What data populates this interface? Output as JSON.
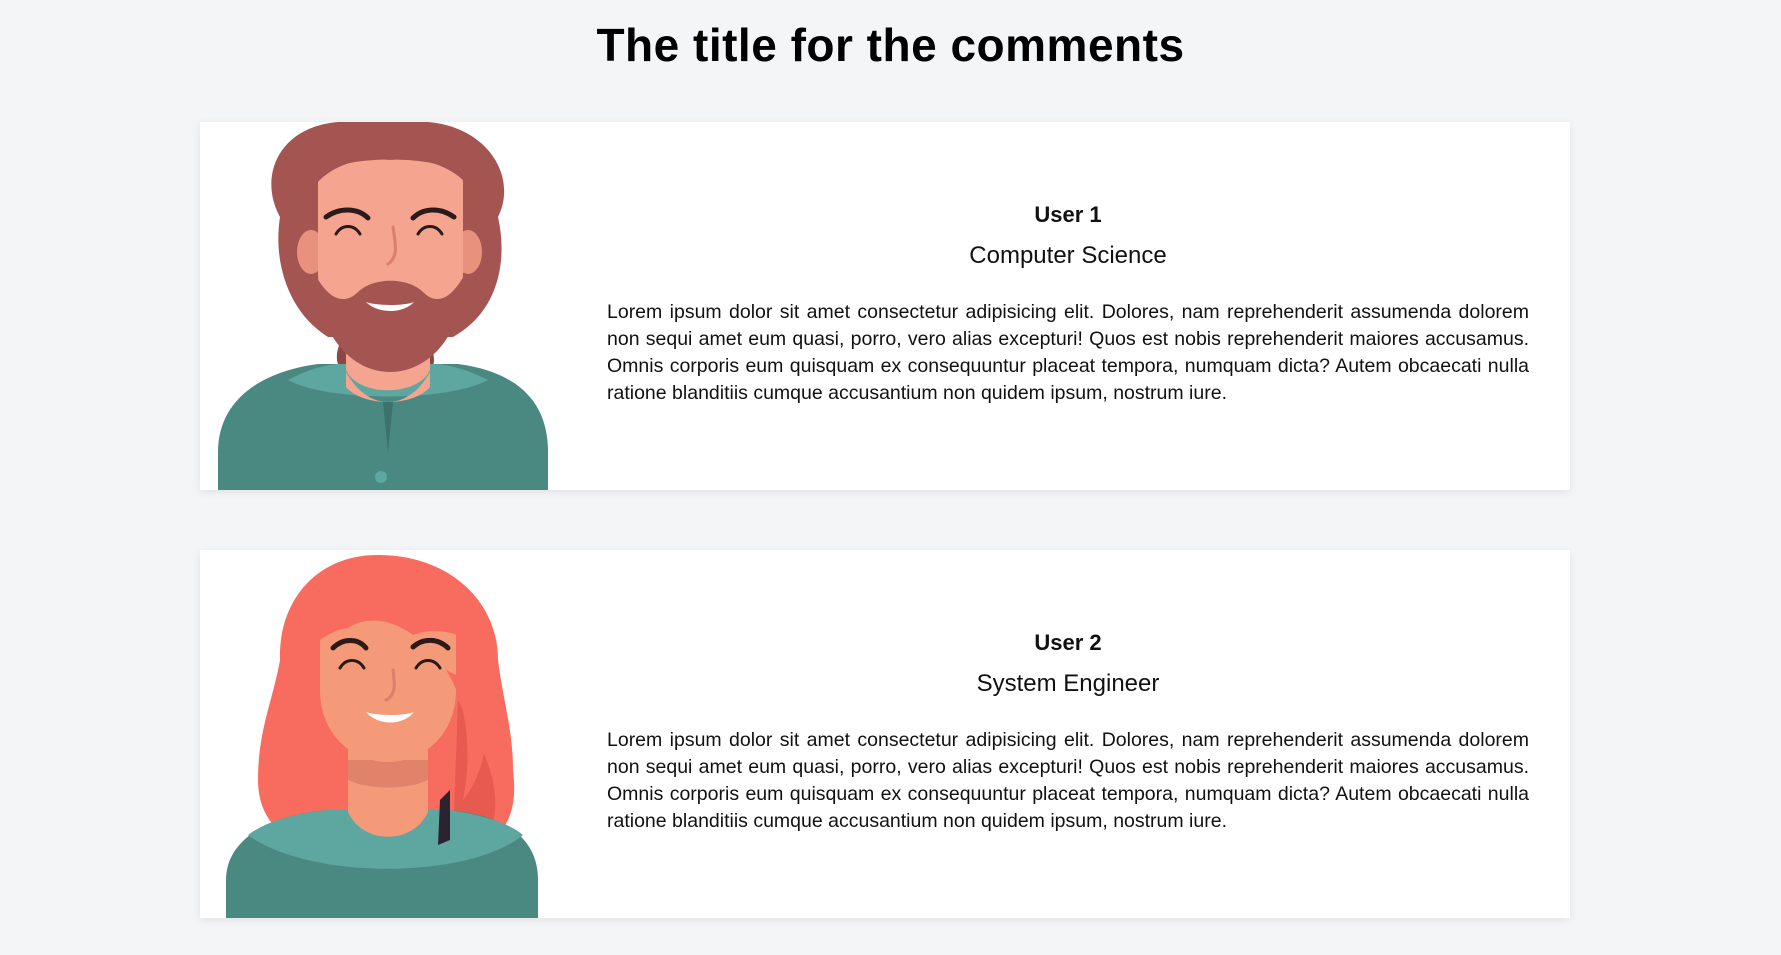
{
  "page": {
    "title": "The title for the comments"
  },
  "comments": [
    {
      "name": "User 1",
      "role": "Computer Science",
      "text": "Lorem ipsum dolor sit amet consectetur adipisicing elit. Dolores, nam reprehenderit assumenda dolorem non sequi amet eum quasi, porro, vero alias excepturi! Quos est nobis reprehenderit maiores accusamus. Omnis corporis eum quisquam ex consequuntur placeat tempora, numquam dicta? Autem obcaecati nulla ratione blanditiis cumque accusantium non quidem ipsum, nostrum iure.",
      "avatar_icon": "bearded-man-avatar"
    },
    {
      "name": "User 2",
      "role": "System Engineer",
      "text": "Lorem ipsum dolor sit amet consectetur adipisicing elit. Dolores, nam reprehenderit assumenda dolorem non sequi amet eum quasi, porro, vero alias excepturi! Quos est nobis reprehenderit maiores accusamus. Omnis corporis eum quisquam ex consequuntur placeat tempora, numquam dicta? Autem obcaecati nulla ratione blanditiis cumque accusantium non quidem ipsum, nostrum iure.",
      "avatar_icon": "red-haired-woman-avatar"
    }
  ],
  "colors": {
    "background": "#f4f5f7",
    "card": "#ffffff",
    "shirt": "#4a8882",
    "shirt_collar": "#5ea7a0",
    "man_hair": "#a55551",
    "man_skin": "#f4a48f",
    "woman_hair": "#f76c5e",
    "woman_skin": "#f59a78"
  }
}
